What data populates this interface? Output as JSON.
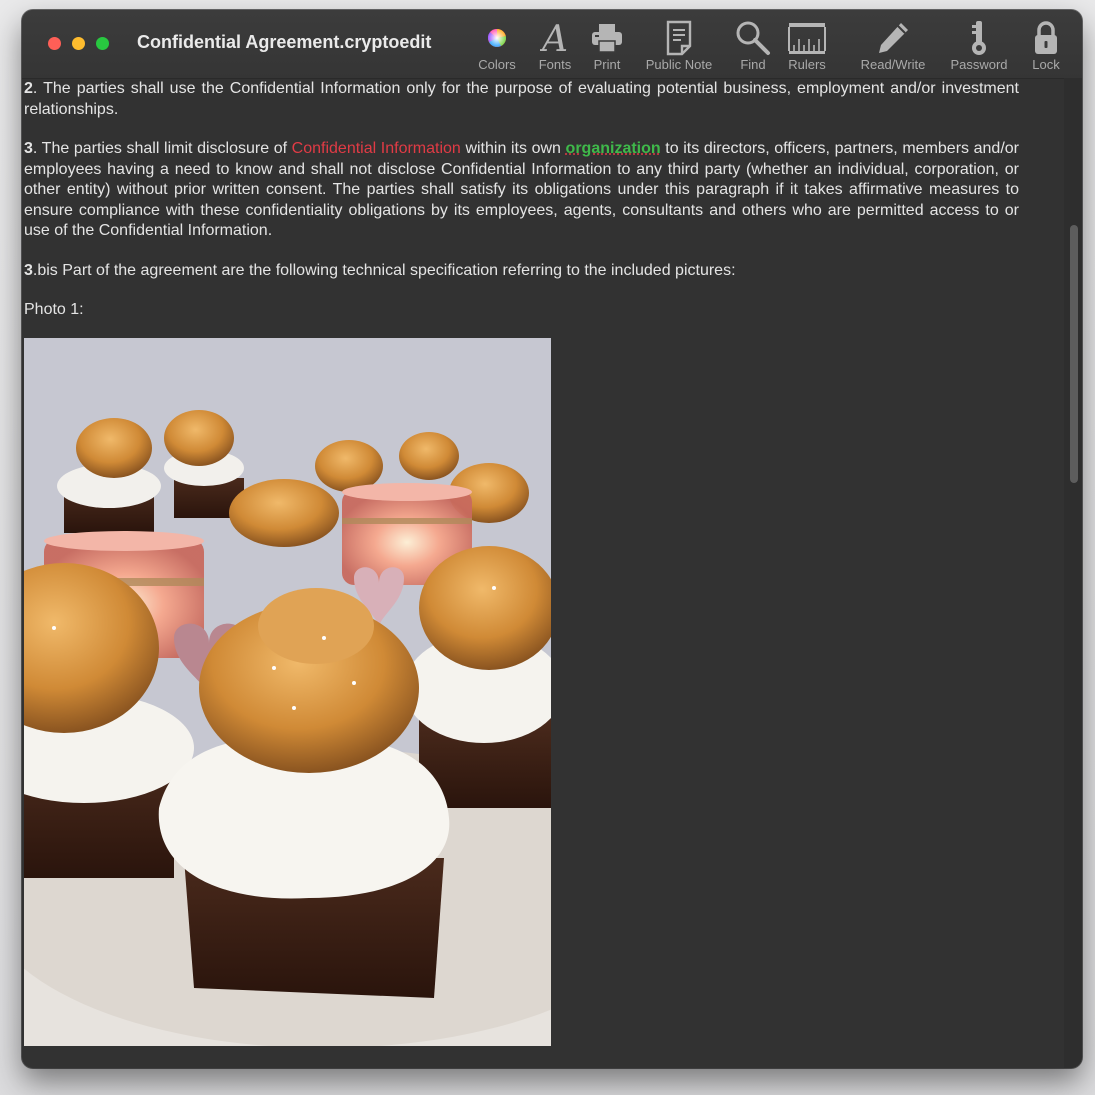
{
  "window": {
    "title": "Confidential Agreement.cryptoedit"
  },
  "toolbar": {
    "items": [
      {
        "label": "Colors",
        "icon": "color-wheel-icon"
      },
      {
        "label": "Fonts",
        "icon": "font-icon"
      },
      {
        "label": "Print",
        "icon": "printer-icon"
      },
      {
        "label": "Public Note",
        "icon": "note-icon"
      },
      {
        "label": "Find",
        "icon": "magnifier-icon"
      },
      {
        "label": "Rulers",
        "icon": "ruler-icon"
      },
      {
        "label": "Read/Write",
        "icon": "pencil-icon"
      },
      {
        "label": "Password",
        "icon": "key-icon"
      },
      {
        "label": "Lock",
        "icon": "lock-icon"
      }
    ]
  },
  "document": {
    "p2": {
      "number": "2",
      "text": ". The parties shall use the Confidential Information only for the purpose of evaluating potential business, employment and/or investment relationships."
    },
    "p3": {
      "number": "3",
      "before": ". The parties shall limit disclosure of ",
      "highlight_red": "Confidential Information",
      "middle": " within its own ",
      "highlight_green": "organization",
      "after": " to its directors, officers, partners, members and/or employees having a need to know and shall not disclose Confidential Information to any third party (whether an individual, corporation, or other entity) without prior written consent. The parties shall satisfy its obligations under this paragraph if it takes affirmative measures to ensure compliance with these confidentiality obligations by its employees, agents, consultants and others who are permitted access to or use of the Confidential Information."
    },
    "p3bis": {
      "number": "3",
      "text": ".bis  Part of the agreement are the following technical specification referring to the included pictures:"
    },
    "photo_label": "Photo 1:"
  },
  "colors": {
    "close": "#fe5f57",
    "minimize": "#febc2e",
    "maximize": "#28c840",
    "highlight_red": "#e03b45",
    "highlight_green": "#3fb94a"
  }
}
